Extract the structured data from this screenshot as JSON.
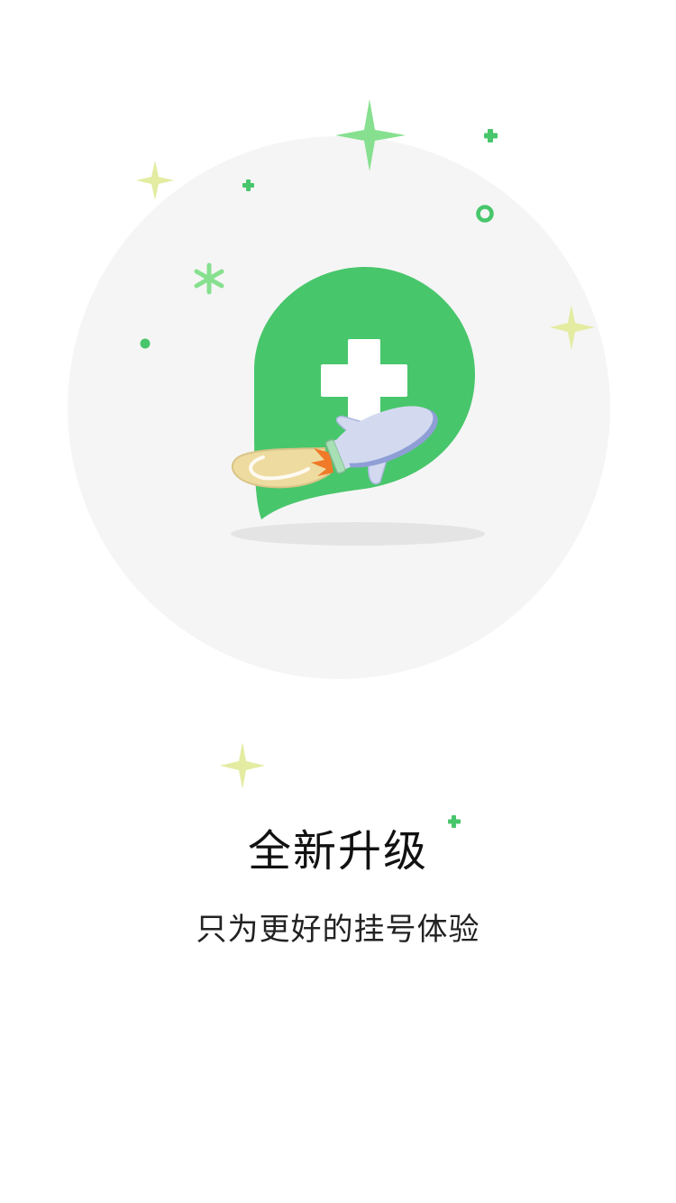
{
  "onboarding": {
    "title": "全新升级",
    "subtitle": "只为更好的挂号体验"
  },
  "colors": {
    "brand_green": "#48c66b",
    "light_green": "#86e08f",
    "spark_yellow": "#e3eca1",
    "circle_bg": "#f5f5f5",
    "shadow": "#e4e4e4",
    "rocket_body": "#d3daf0",
    "rocket_trim": "#8f9fd6",
    "trail": "#eedba0",
    "flame": "#f07a28"
  },
  "icons": {
    "hero": "hospital-cross-rocket-illustration"
  }
}
